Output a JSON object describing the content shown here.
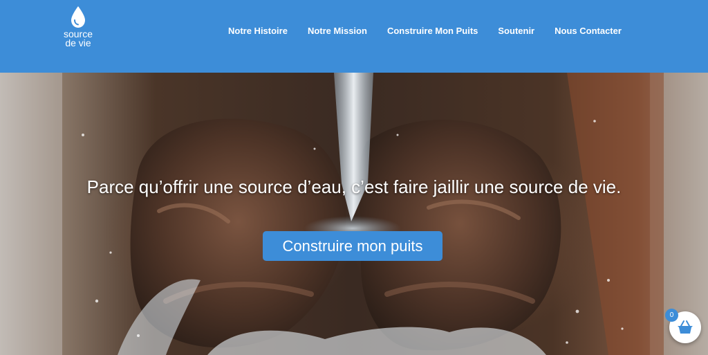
{
  "header": {
    "logo": {
      "icon": "water-drop-icon",
      "text": "source\nde vie"
    },
    "nav": [
      {
        "label": "Notre Histoire"
      },
      {
        "label": "Notre Mission"
      },
      {
        "label": "Construire Mon Puits"
      },
      {
        "label": "Soutenir"
      },
      {
        "label": "Nous Contacter"
      }
    ]
  },
  "hero": {
    "headline": "Parce qu’offrir une source d’eau, c’est faire jaillir une source de vie.",
    "cta_label": "Construire mon puits",
    "image_subject": "cupped hands catching pouring water"
  },
  "cart": {
    "icon": "basket-icon",
    "count": "0"
  },
  "colors": {
    "brand_blue": "#3d8dd8",
    "text_white": "#ffffff"
  }
}
